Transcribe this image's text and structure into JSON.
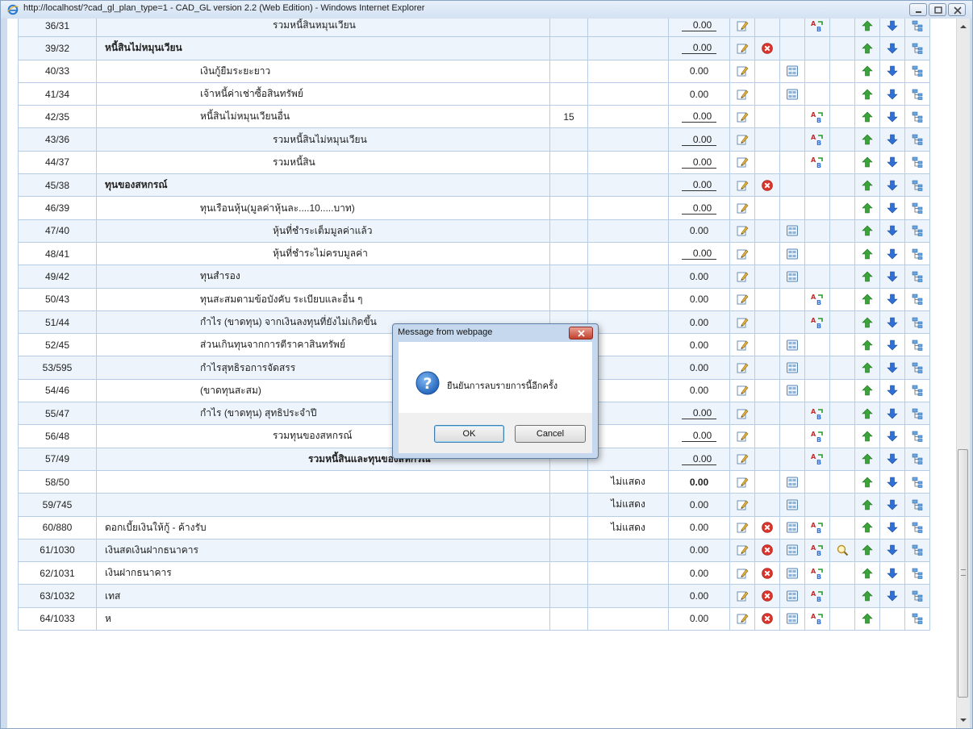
{
  "window": {
    "title": "http://localhost/?cad_gl_plan_type=1 - CAD_GL version 2.2 (Web Edition) - Windows Internet Explorer"
  },
  "icons": {
    "edit": "edit-icon",
    "delete": "delete-icon",
    "sub": "sub-account-icon",
    "formula": "formula-icon",
    "find": "search-icon",
    "up": "move-up-icon",
    "down": "move-down-icon",
    "tree": "tree-icon"
  },
  "rows": [
    {
      "code": "36/31",
      "name": "รวมหนี้สินหมุนเวียน",
      "indent": 3,
      "bold": false,
      "note": "",
      "show": "",
      "amount": "0.00",
      "amt_ul": true,
      "amt_bold": false,
      "del": false,
      "sub": false,
      "formula": true,
      "find": false,
      "up": true,
      "down": true,
      "alt": true
    },
    {
      "code": "39/32",
      "name": "หนี้สินไม่หมุนเวียน",
      "indent": 0,
      "bold": true,
      "note": "",
      "show": "",
      "amount": "0.00",
      "amt_ul": true,
      "amt_bold": false,
      "del": true,
      "sub": false,
      "formula": false,
      "find": false,
      "up": true,
      "down": true,
      "alt": true
    },
    {
      "code": "40/33",
      "name": "เงินกู้ยืมระยะยาว",
      "indent": 2,
      "bold": false,
      "note": "",
      "show": "",
      "amount": "0.00",
      "amt_ul": false,
      "amt_bold": false,
      "del": false,
      "sub": true,
      "formula": false,
      "find": false,
      "up": true,
      "down": true,
      "alt": false
    },
    {
      "code": "41/34",
      "name": "เจ้าหนี้ค่าเช่าซื้อสินทรัพย์",
      "indent": 2,
      "bold": false,
      "note": "",
      "show": "",
      "amount": "0.00",
      "amt_ul": false,
      "amt_bold": false,
      "del": false,
      "sub": true,
      "formula": false,
      "find": false,
      "up": true,
      "down": true,
      "alt": false
    },
    {
      "code": "42/35",
      "name": "หนี้สินไม่หมุนเวียนอื่น",
      "indent": 2,
      "bold": false,
      "note": "15",
      "show": "",
      "amount": "0.00",
      "amt_ul": true,
      "amt_bold": false,
      "del": false,
      "sub": false,
      "formula": true,
      "find": false,
      "up": true,
      "down": true,
      "alt": false
    },
    {
      "code": "43/36",
      "name": "รวมหนี้สินไม่หมุนเวียน",
      "indent": 3,
      "bold": false,
      "note": "",
      "show": "",
      "amount": "0.00",
      "amt_ul": true,
      "amt_bold": false,
      "del": false,
      "sub": false,
      "formula": true,
      "find": false,
      "up": true,
      "down": true,
      "alt": true
    },
    {
      "code": "44/37",
      "name": "รวมหนี้สิน",
      "indent": 3,
      "bold": false,
      "note": "",
      "show": "",
      "amount": "0.00",
      "amt_ul": true,
      "amt_bold": false,
      "del": false,
      "sub": false,
      "formula": true,
      "find": false,
      "up": true,
      "down": true,
      "alt": false
    },
    {
      "code": "45/38",
      "name": "ทุนของสหกรณ์",
      "indent": 0,
      "bold": true,
      "note": "",
      "show": "",
      "amount": "0.00",
      "amt_ul": true,
      "amt_bold": false,
      "del": true,
      "sub": false,
      "formula": false,
      "find": false,
      "up": true,
      "down": true,
      "alt": true
    },
    {
      "code": "46/39",
      "name": "ทุนเรือนหุ้น(มูลค่าหุ้นละ....10.....บาท)",
      "indent": 2,
      "bold": false,
      "note": "",
      "show": "",
      "amount": "0.00",
      "amt_ul": true,
      "amt_bold": false,
      "del": false,
      "sub": false,
      "formula": false,
      "find": false,
      "up": true,
      "down": true,
      "alt": false
    },
    {
      "code": "47/40",
      "name": "หุ้นที่ชำระเต็มมูลค่าแล้ว",
      "indent": 3,
      "bold": false,
      "note": "",
      "show": "",
      "amount": "0.00",
      "amt_ul": false,
      "amt_bold": false,
      "del": false,
      "sub": true,
      "formula": false,
      "find": false,
      "up": true,
      "down": true,
      "alt": true
    },
    {
      "code": "48/41",
      "name": "หุ้นที่ชำระไม่ครบมูลค่า",
      "indent": 3,
      "bold": false,
      "note": "",
      "show": "",
      "amount": "0.00",
      "amt_ul": true,
      "amt_bold": false,
      "del": false,
      "sub": true,
      "formula": false,
      "find": false,
      "up": true,
      "down": true,
      "alt": false
    },
    {
      "code": "49/42",
      "name": "ทุนสำรอง",
      "indent": 2,
      "bold": false,
      "note": "",
      "show": "",
      "amount": "0.00",
      "amt_ul": false,
      "amt_bold": false,
      "del": false,
      "sub": true,
      "formula": false,
      "find": false,
      "up": true,
      "down": true,
      "alt": true
    },
    {
      "code": "50/43",
      "name": "ทุนสะสมตามข้อบังคับ ระเบียบและอื่น ๆ",
      "indent": 2,
      "bold": false,
      "note": "",
      "show": "",
      "amount": "0.00",
      "amt_ul": false,
      "amt_bold": false,
      "del": false,
      "sub": false,
      "formula": true,
      "find": false,
      "up": true,
      "down": true,
      "alt": false
    },
    {
      "code": "51/44",
      "name": "กำไร (ขาดทุน) จากเงินลงทุนที่ยังไม่เกิดขึ้น",
      "indent": 2,
      "bold": false,
      "note": "",
      "show": "",
      "amount": "0.00",
      "amt_ul": false,
      "amt_bold": false,
      "del": false,
      "sub": false,
      "formula": true,
      "find": false,
      "up": true,
      "down": true,
      "alt": true
    },
    {
      "code": "52/45",
      "name": "ส่วนเกินทุนจากการตีราคาสินทรัพย์",
      "indent": 2,
      "bold": false,
      "note": "",
      "show": "",
      "amount": "0.00",
      "amt_ul": false,
      "amt_bold": false,
      "del": false,
      "sub": true,
      "formula": false,
      "find": false,
      "up": true,
      "down": true,
      "alt": false
    },
    {
      "code": "53/595",
      "name": "กำไรสุทธิรอการจัดสรร",
      "indent": 2,
      "bold": false,
      "note": "",
      "show": "",
      "amount": "0.00",
      "amt_ul": false,
      "amt_bold": false,
      "del": false,
      "sub": true,
      "formula": false,
      "find": false,
      "up": true,
      "down": true,
      "alt": true
    },
    {
      "code": "54/46",
      "name": "(ขาดทุนสะสม)",
      "indent": 2,
      "bold": false,
      "note": "",
      "show": "",
      "amount": "0.00",
      "amt_ul": false,
      "amt_bold": false,
      "del": false,
      "sub": true,
      "formula": false,
      "find": false,
      "up": true,
      "down": true,
      "alt": false
    },
    {
      "code": "55/47",
      "name": "กำไร (ขาดทุน) สุทธิประจำปี",
      "indent": 2,
      "bold": false,
      "note": "",
      "show": "",
      "amount": "0.00",
      "amt_ul": true,
      "amt_bold": false,
      "del": false,
      "sub": false,
      "formula": true,
      "find": false,
      "up": true,
      "down": true,
      "alt": true
    },
    {
      "code": "56/48",
      "name": "รวมทุนของสหกรณ์",
      "indent": 3,
      "bold": false,
      "note": "",
      "show": "",
      "amount": "0.00",
      "amt_ul": true,
      "amt_bold": false,
      "del": false,
      "sub": false,
      "formula": true,
      "find": false,
      "up": true,
      "down": true,
      "alt": false
    },
    {
      "code": "57/49",
      "name": "รวมหนี้สินและทุนของสหกรณ์",
      "indent": 4,
      "bold": true,
      "note": "",
      "show": "",
      "amount": "0.00",
      "amt_ul": true,
      "amt_bold": false,
      "del": false,
      "sub": false,
      "formula": true,
      "find": false,
      "up": true,
      "down": true,
      "alt": true
    },
    {
      "code": "58/50",
      "name": "",
      "indent": 0,
      "bold": false,
      "note": "",
      "show": "ไม่แสดง",
      "amount": "0.00",
      "amt_ul": false,
      "amt_bold": true,
      "del": false,
      "sub": true,
      "formula": false,
      "find": false,
      "up": true,
      "down": true,
      "alt": false
    },
    {
      "code": "59/745",
      "name": "",
      "indent": 0,
      "bold": false,
      "note": "",
      "show": "ไม่แสดง",
      "amount": "0.00",
      "amt_ul": false,
      "amt_bold": false,
      "del": false,
      "sub": true,
      "formula": false,
      "find": false,
      "up": true,
      "down": true,
      "alt": true
    },
    {
      "code": "60/880",
      "name": "ดอกเบี้ยเงินให้กู้ - ค้างรับ",
      "indent": 0,
      "bold": false,
      "note": "",
      "show": "ไม่แสดง",
      "amount": "0.00",
      "amt_ul": false,
      "amt_bold": false,
      "del": true,
      "sub": true,
      "formula": true,
      "find": false,
      "up": true,
      "down": true,
      "alt": false
    },
    {
      "code": "61/1030",
      "name": "เงินสดเงินฝากธนาคาร",
      "indent": 0,
      "bold": false,
      "note": "",
      "show": "",
      "amount": "0.00",
      "amt_ul": false,
      "amt_bold": false,
      "del": true,
      "sub": true,
      "formula": true,
      "find": true,
      "up": true,
      "down": true,
      "alt": true
    },
    {
      "code": "62/1031",
      "name": "เงินฝากธนาคาร",
      "indent": 0,
      "bold": false,
      "note": "",
      "show": "",
      "amount": "0.00",
      "amt_ul": false,
      "amt_bold": false,
      "del": true,
      "sub": true,
      "formula": true,
      "find": false,
      "up": true,
      "down": true,
      "alt": false
    },
    {
      "code": "63/1032",
      "name": "เทส",
      "indent": 0,
      "bold": false,
      "note": "",
      "show": "",
      "amount": "0.00",
      "amt_ul": false,
      "amt_bold": false,
      "del": true,
      "sub": true,
      "formula": true,
      "find": false,
      "up": true,
      "down": true,
      "alt": true
    },
    {
      "code": "64/1033",
      "name": "ห",
      "indent": 0,
      "bold": false,
      "note": "",
      "show": "",
      "amount": "0.00",
      "amt_ul": false,
      "amt_bold": false,
      "del": true,
      "sub": true,
      "formula": true,
      "find": false,
      "up": true,
      "down": false,
      "alt": false
    }
  ],
  "dialog": {
    "title": "Message from webpage",
    "message": "ยืนยันการลบรายการนี้อีกครั้ง",
    "ok_label": "OK",
    "cancel_label": "Cancel",
    "icon": "question-icon"
  },
  "colors": {
    "row_alt": "#eef4fb",
    "grid_border": "#b7cde6",
    "up_arrow": "#3aa33a",
    "down_arrow": "#2f6fd6",
    "delete": "#d9342b"
  }
}
